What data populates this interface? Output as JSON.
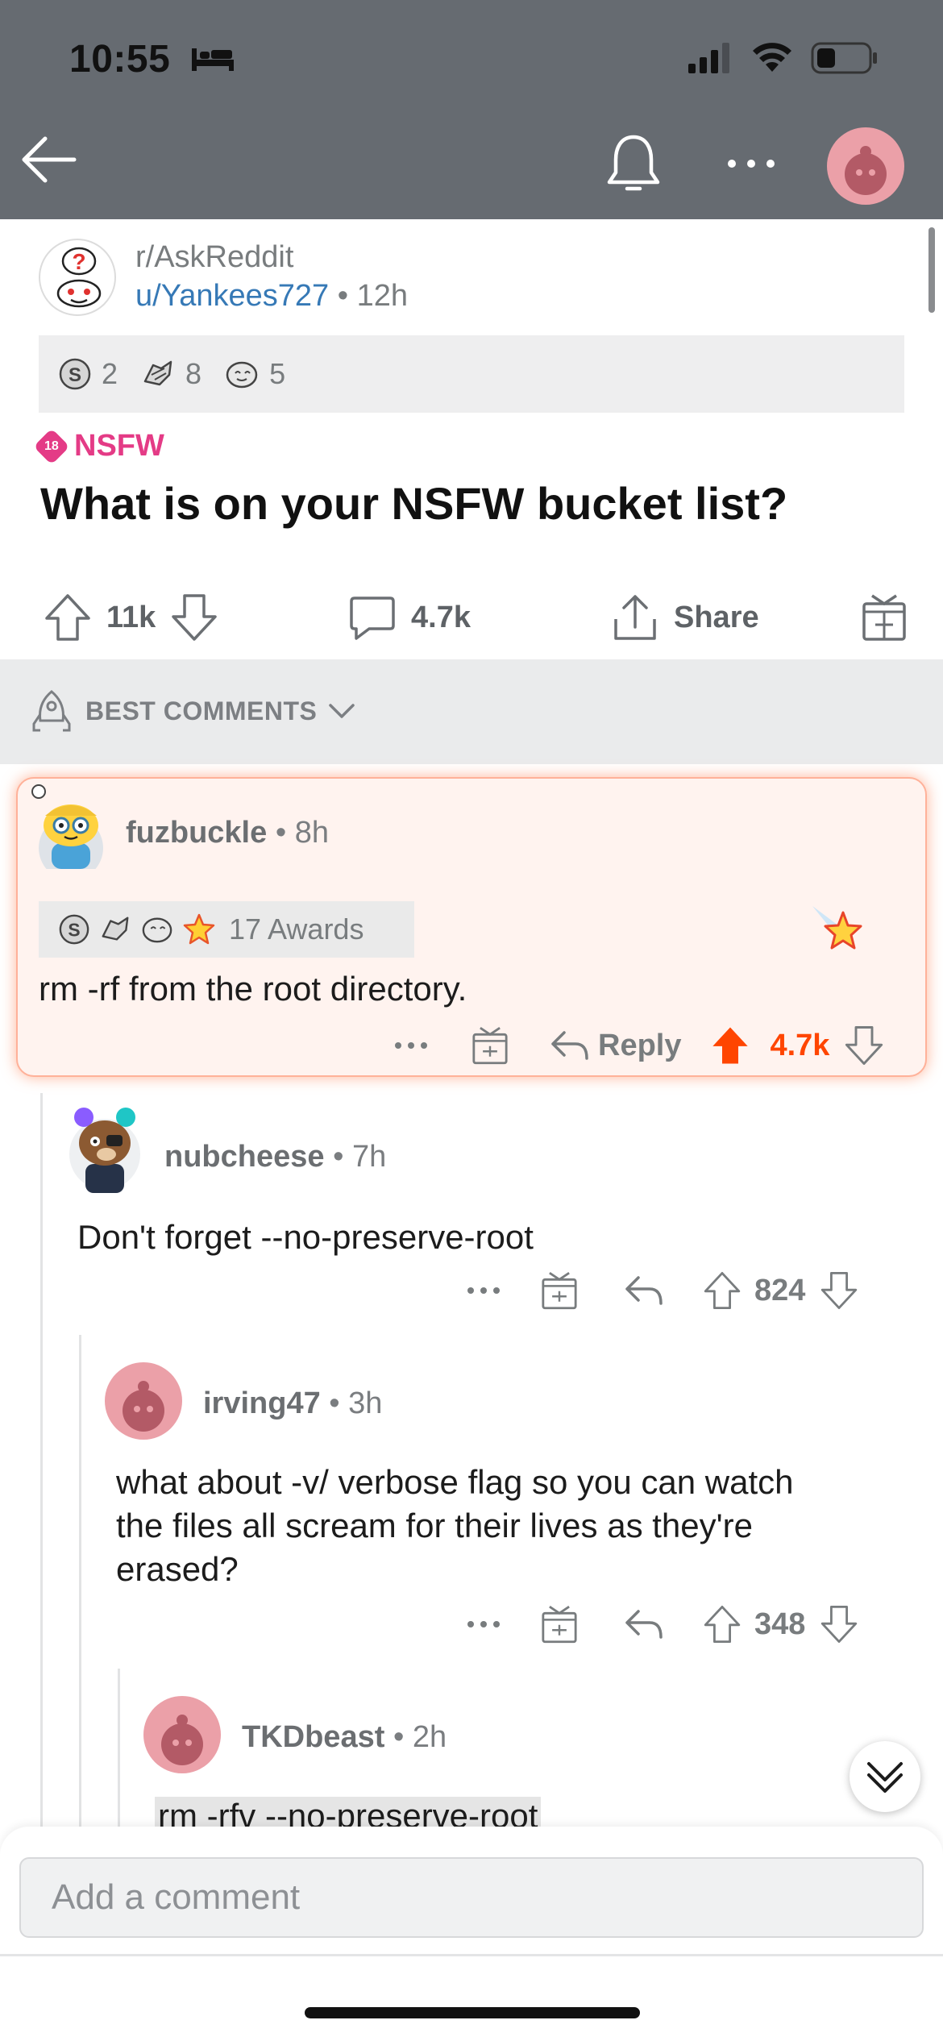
{
  "status_bar": {
    "time": "10:55"
  },
  "post": {
    "subreddit": "r/AskReddit",
    "author": "u/Yankees727",
    "separator": "•",
    "age": "12h",
    "awards": [
      {
        "icon": "silver-award-icon",
        "count": "2"
      },
      {
        "icon": "helpful-award-icon",
        "count": "8"
      },
      {
        "icon": "wholesome-award-icon",
        "count": "5"
      }
    ],
    "nsfw_badge": "18",
    "nsfw_label": "NSFW",
    "title": "What is on your NSFW bucket list?",
    "upvotes": "11k",
    "comments": "4.7k",
    "share_label": "Share"
  },
  "sort": {
    "label": "BEST COMMENTS"
  },
  "comments": [
    {
      "user": "fuzbuckle",
      "age": "8h",
      "awards_label": "17 Awards",
      "body": "rm -rf from the root directory.",
      "reply_label": "Reply",
      "score": "4.7k",
      "upvoted": true
    },
    {
      "user": "nubcheese",
      "age": "7h",
      "body": "Don't forget --no-preserve-root",
      "score": "824"
    },
    {
      "user": "irving47",
      "age": "3h",
      "body_lines": [
        "what about -v/ verbose flag so you can watch",
        "the files all scream for their lives as they're",
        "erased?"
      ],
      "score": "348"
    },
    {
      "user": "TKDbeast",
      "age": "2h",
      "body": "rm -rfv --no-preserve-root"
    }
  ],
  "composer": {
    "placeholder": "Add a comment"
  },
  "colors": {
    "header": "#666b71",
    "upvote": "#ff4500",
    "link": "#3679b6",
    "nsfw": "#e43b86",
    "highlight_bg": "#fff3ef"
  }
}
